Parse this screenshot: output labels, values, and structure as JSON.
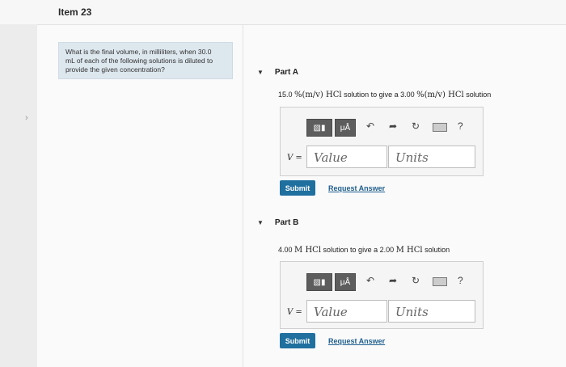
{
  "item": {
    "title": "Item 23"
  },
  "question": {
    "line1": "What is the final volume, in milliliters, when 30.0",
    "line2": "mL of each of the following solutions is diluted to",
    "line3": "provide the given concentration?"
  },
  "parts": [
    {
      "label": "Part A",
      "prompt_prefix": "15.0 ",
      "prompt_math1": "%(m/v) HCl",
      "prompt_mid": " solution to give a 3.00 ",
      "prompt_math2": "%(m/v) HCl",
      "prompt_suffix": " solution",
      "var_label": "V =",
      "value_placeholder": "Value",
      "units_placeholder": "Units",
      "submit_label": "Submit",
      "request_label": "Request Answer"
    },
    {
      "label": "Part B",
      "prompt_prefix": "4.00 ",
      "prompt_math1": "M HCl",
      "prompt_mid": " solution to give a 2.00 ",
      "prompt_math2": "M HCl",
      "prompt_suffix": " solution",
      "var_label": "V =",
      "value_placeholder": "Value",
      "units_placeholder": "Units",
      "submit_label": "Submit",
      "request_label": "Request Answer"
    }
  ],
  "toolbar": {
    "templates_icon": "templates-icon",
    "units_label": "μÅ",
    "undo_icon": "undo-icon",
    "redo_icon": "redo-icon",
    "reset_icon": "reset-icon",
    "keyboard_icon": "keyboard-icon",
    "help_label": "?"
  },
  "colors": {
    "submit": "#1f6f9f",
    "link": "#1f5f8f",
    "question_bg": "#dde7ee"
  }
}
